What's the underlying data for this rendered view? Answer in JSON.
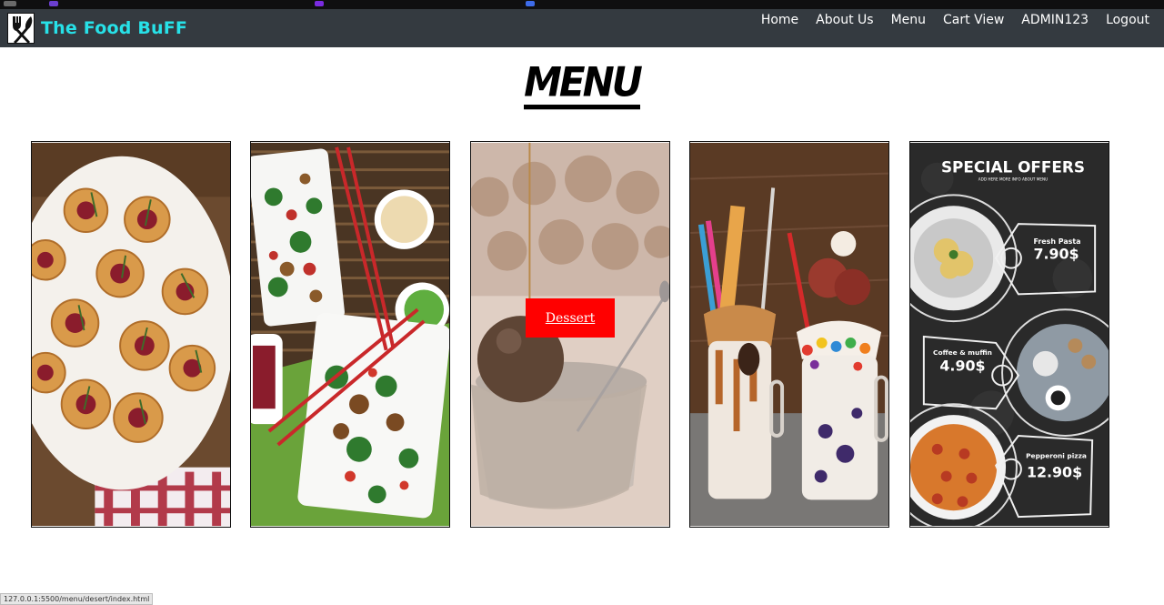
{
  "brand": {
    "name": "The Food BuFF",
    "logo_icon": "fork-knife-icon"
  },
  "nav": [
    "Home",
    "About Us",
    "Menu",
    "Cart View",
    "ADMIN123",
    "Logout"
  ],
  "page_title": "MENU",
  "cards": [
    {
      "name": "appetizers-card"
    },
    {
      "name": "main-course-card"
    },
    {
      "name": "dessert-card",
      "button_label": "Dessert"
    },
    {
      "name": "shakes-card"
    },
    {
      "name": "special-offers-card",
      "heading": "SPECIAL OFFERS",
      "subheading": "ADD HERE MORE INFO ABOUT MENU",
      "offers": [
        {
          "item": "Fresh Pasta",
          "price": "7.90$"
        },
        {
          "item": "Coffee & muffin",
          "price": "4.90$"
        },
        {
          "item": "Pepperoni pizza",
          "price": "12.90$"
        }
      ]
    }
  ],
  "status_bar_url": "127.0.0.1:5500/menu/desert/index.html",
  "colors": {
    "navbar": "#343a40",
    "brand": "#27e1e8",
    "button": "#ff0000"
  }
}
